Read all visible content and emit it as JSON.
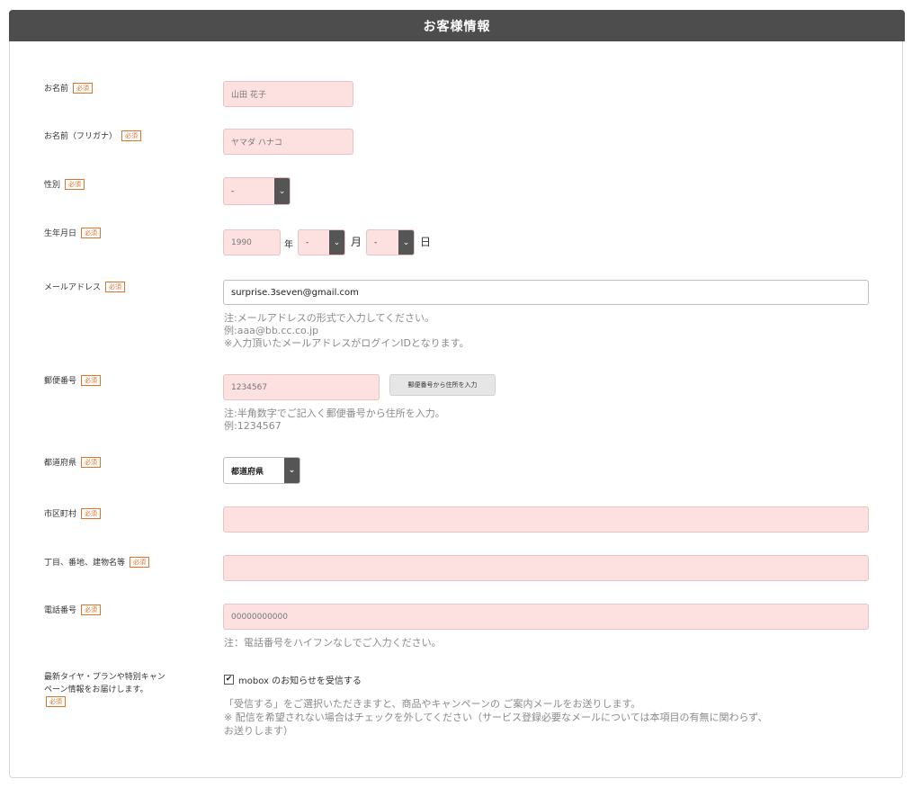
{
  "header": {
    "title": "お客様情報"
  },
  "required_label": "必須",
  "fields": {
    "name": {
      "label": "お名前",
      "value": "山田 花子"
    },
    "kana": {
      "label": "お名前（フリガナ）",
      "value": "ヤマダ ハナコ"
    },
    "gender": {
      "label": "性別",
      "value": "-"
    },
    "birth": {
      "label": "生年月日",
      "year": "1990",
      "year_unit": "年",
      "month": "-",
      "month_unit": "月",
      "day": "-",
      "day_unit": "日"
    },
    "email": {
      "label": "メールアドレス",
      "value": "surprise.3seven@gmail.com",
      "notes": [
        "注:メールアドレスの形式で入力してください。",
        "例:aaa@bb.cc.co.jp",
        "※入力頂いたメールアドレスがログインIDとなります。"
      ]
    },
    "postal": {
      "label": "郵便番号",
      "value": "1234567",
      "button": "郵便番号から住所を入力",
      "notes": [
        "注:半角数字でご記入く郵便番号から住所を入力。",
        "例:1234567"
      ]
    },
    "prefecture": {
      "label": "都道府県",
      "value": "都道府県"
    },
    "city": {
      "label": "市区町村",
      "value": ""
    },
    "address": {
      "label": "丁目、番地、建物名等",
      "value": ""
    },
    "phone": {
      "label": "電話番号",
      "value": "00000000000",
      "note": "注：電話番号をハイフンなしでご入力ください。"
    },
    "newsletter": {
      "label_line1": "最新タイヤ・プランや特別キャン",
      "label_line2": "ペーン情報をお届けします。",
      "checkbox_label": "mobox のお知らせを受信する",
      "checked": true,
      "notes": [
        "「受信する」をご選択いただきますと、商品やキャンペーンの ご案内メールをお送りします。",
        "※ 配信を希望されない場合はチェックを外してください（サービス登録必要なメールについては本項目の有無に関わらず、",
        "お送りします）"
      ]
    }
  }
}
